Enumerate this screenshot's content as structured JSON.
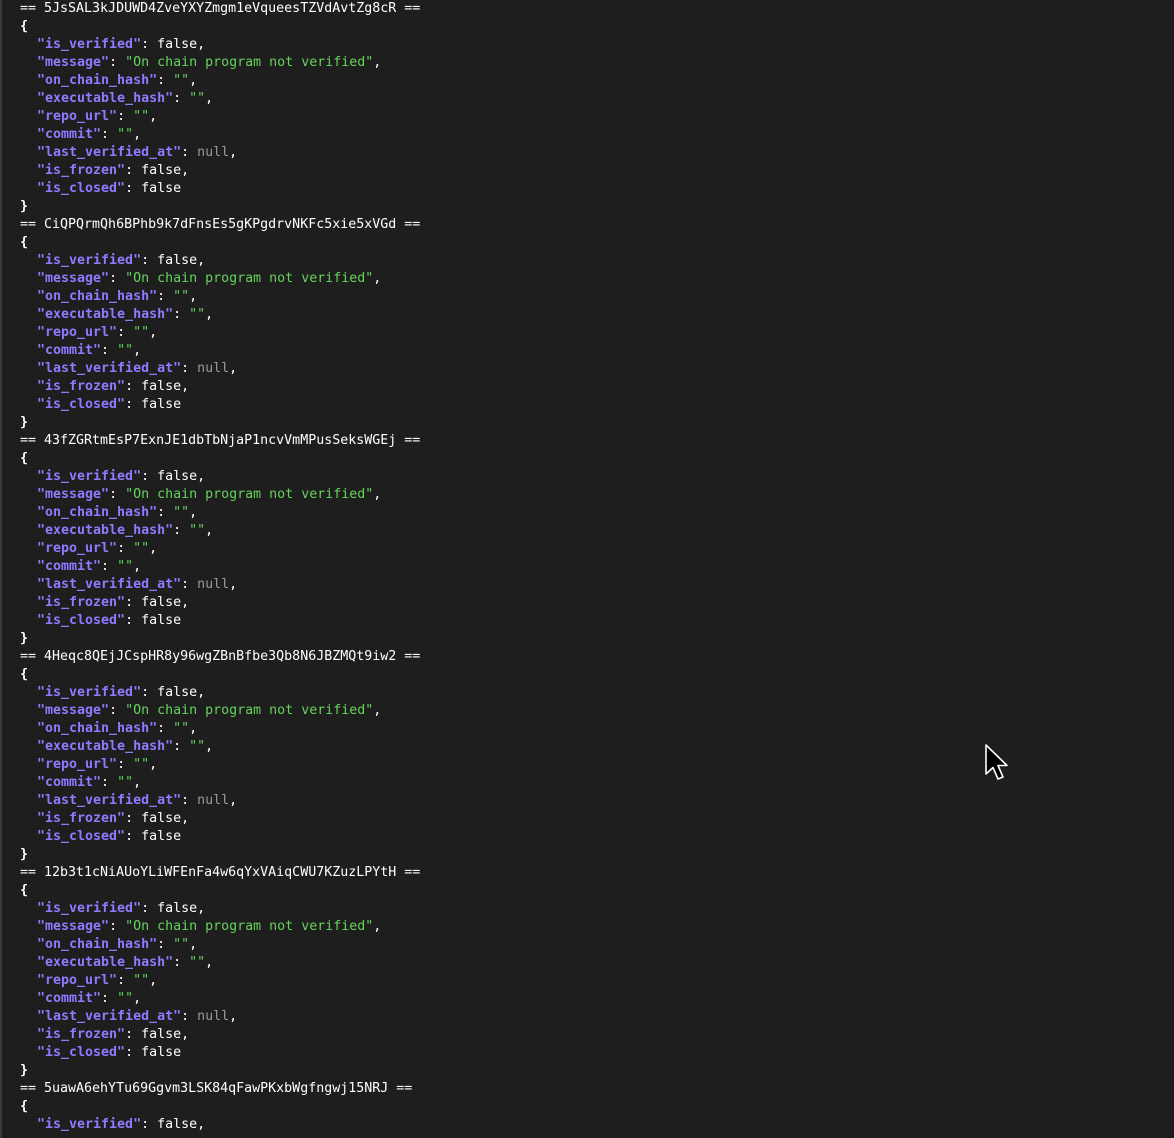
{
  "terminal": {
    "blocks": [
      {
        "header": "== 5JsSAL3kJDUWD4ZveYXYZmgm1eVqueesTZVdAvtZg8cR ==",
        "open": "{",
        "close": "}",
        "fields": [
          {
            "key": "\"is_verified\"",
            "colon": ": ",
            "value": "false",
            "type": "bool",
            "comma": ","
          },
          {
            "key": "\"message\"",
            "colon": ": ",
            "value": "\"On chain program not verified\"",
            "type": "str",
            "comma": ","
          },
          {
            "key": "\"on_chain_hash\"",
            "colon": ": ",
            "value": "\"\"",
            "type": "str",
            "comma": ","
          },
          {
            "key": "\"executable_hash\"",
            "colon": ": ",
            "value": "\"\"",
            "type": "str",
            "comma": ","
          },
          {
            "key": "\"repo_url\"",
            "colon": ": ",
            "value": "\"\"",
            "type": "str",
            "comma": ","
          },
          {
            "key": "\"commit\"",
            "colon": ": ",
            "value": "\"\"",
            "type": "str",
            "comma": ","
          },
          {
            "key": "\"last_verified_at\"",
            "colon": ": ",
            "value": "null",
            "type": "null",
            "comma": ","
          },
          {
            "key": "\"is_frozen\"",
            "colon": ": ",
            "value": "false",
            "type": "bool",
            "comma": ","
          },
          {
            "key": "\"is_closed\"",
            "colon": ": ",
            "value": "false",
            "type": "bool",
            "comma": ""
          }
        ]
      },
      {
        "header": "== CiQPQrmQh6BPhb9k7dFnsEs5gKPgdrvNKFc5xie5xVGd ==",
        "open": "{",
        "close": "}",
        "fields": [
          {
            "key": "\"is_verified\"",
            "colon": ": ",
            "value": "false",
            "type": "bool",
            "comma": ","
          },
          {
            "key": "\"message\"",
            "colon": ": ",
            "value": "\"On chain program not verified\"",
            "type": "str",
            "comma": ","
          },
          {
            "key": "\"on_chain_hash\"",
            "colon": ": ",
            "value": "\"\"",
            "type": "str",
            "comma": ","
          },
          {
            "key": "\"executable_hash\"",
            "colon": ": ",
            "value": "\"\"",
            "type": "str",
            "comma": ","
          },
          {
            "key": "\"repo_url\"",
            "colon": ": ",
            "value": "\"\"",
            "type": "str",
            "comma": ","
          },
          {
            "key": "\"commit\"",
            "colon": ": ",
            "value": "\"\"",
            "type": "str",
            "comma": ","
          },
          {
            "key": "\"last_verified_at\"",
            "colon": ": ",
            "value": "null",
            "type": "null",
            "comma": ","
          },
          {
            "key": "\"is_frozen\"",
            "colon": ": ",
            "value": "false",
            "type": "bool",
            "comma": ","
          },
          {
            "key": "\"is_closed\"",
            "colon": ": ",
            "value": "false",
            "type": "bool",
            "comma": ""
          }
        ]
      },
      {
        "header": "== 43fZGRtmEsP7ExnJE1dbTbNjaP1ncvVmMPusSeksWGEj ==",
        "open": "{",
        "close": "}",
        "fields": [
          {
            "key": "\"is_verified\"",
            "colon": ": ",
            "value": "false",
            "type": "bool",
            "comma": ","
          },
          {
            "key": "\"message\"",
            "colon": ": ",
            "value": "\"On chain program not verified\"",
            "type": "str",
            "comma": ","
          },
          {
            "key": "\"on_chain_hash\"",
            "colon": ": ",
            "value": "\"\"",
            "type": "str",
            "comma": ","
          },
          {
            "key": "\"executable_hash\"",
            "colon": ": ",
            "value": "\"\"",
            "type": "str",
            "comma": ","
          },
          {
            "key": "\"repo_url\"",
            "colon": ": ",
            "value": "\"\"",
            "type": "str",
            "comma": ","
          },
          {
            "key": "\"commit\"",
            "colon": ": ",
            "value": "\"\"",
            "type": "str",
            "comma": ","
          },
          {
            "key": "\"last_verified_at\"",
            "colon": ": ",
            "value": "null",
            "type": "null",
            "comma": ","
          },
          {
            "key": "\"is_frozen\"",
            "colon": ": ",
            "value": "false",
            "type": "bool",
            "comma": ","
          },
          {
            "key": "\"is_closed\"",
            "colon": ": ",
            "value": "false",
            "type": "bool",
            "comma": ""
          }
        ]
      },
      {
        "header": "== 4Heqc8QEjJCspHR8y96wgZBnBfbe3Qb8N6JBZMQt9iw2 ==",
        "open": "{",
        "close": "}",
        "fields": [
          {
            "key": "\"is_verified\"",
            "colon": ": ",
            "value": "false",
            "type": "bool",
            "comma": ","
          },
          {
            "key": "\"message\"",
            "colon": ": ",
            "value": "\"On chain program not verified\"",
            "type": "str",
            "comma": ","
          },
          {
            "key": "\"on_chain_hash\"",
            "colon": ": ",
            "value": "\"\"",
            "type": "str",
            "comma": ","
          },
          {
            "key": "\"executable_hash\"",
            "colon": ": ",
            "value": "\"\"",
            "type": "str",
            "comma": ","
          },
          {
            "key": "\"repo_url\"",
            "colon": ": ",
            "value": "\"\"",
            "type": "str",
            "comma": ","
          },
          {
            "key": "\"commit\"",
            "colon": ": ",
            "value": "\"\"",
            "type": "str",
            "comma": ","
          },
          {
            "key": "\"last_verified_at\"",
            "colon": ": ",
            "value": "null",
            "type": "null",
            "comma": ","
          },
          {
            "key": "\"is_frozen\"",
            "colon": ": ",
            "value": "false",
            "type": "bool",
            "comma": ","
          },
          {
            "key": "\"is_closed\"",
            "colon": ": ",
            "value": "false",
            "type": "bool",
            "comma": ""
          }
        ]
      },
      {
        "header": "== 12b3t1cNiAUoYLiWFEnFa4w6qYxVAiqCWU7KZuzLPYtH ==",
        "open": "{",
        "close": "}",
        "fields": [
          {
            "key": "\"is_verified\"",
            "colon": ": ",
            "value": "false",
            "type": "bool",
            "comma": ","
          },
          {
            "key": "\"message\"",
            "colon": ": ",
            "value": "\"On chain program not verified\"",
            "type": "str",
            "comma": ","
          },
          {
            "key": "\"on_chain_hash\"",
            "colon": ": ",
            "value": "\"\"",
            "type": "str",
            "comma": ","
          },
          {
            "key": "\"executable_hash\"",
            "colon": ": ",
            "value": "\"\"",
            "type": "str",
            "comma": ","
          },
          {
            "key": "\"repo_url\"",
            "colon": ": ",
            "value": "\"\"",
            "type": "str",
            "comma": ","
          },
          {
            "key": "\"commit\"",
            "colon": ": ",
            "value": "\"\"",
            "type": "str",
            "comma": ","
          },
          {
            "key": "\"last_verified_at\"",
            "colon": ": ",
            "value": "null",
            "type": "null",
            "comma": ","
          },
          {
            "key": "\"is_frozen\"",
            "colon": ": ",
            "value": "false",
            "type": "bool",
            "comma": ","
          },
          {
            "key": "\"is_closed\"",
            "colon": ": ",
            "value": "false",
            "type": "bool",
            "comma": ""
          }
        ]
      },
      {
        "header": "== 5uawA6ehYTu69Ggvm3LSK84qFawPKxbWgfngwj15NRJ ==",
        "open": "{",
        "close": "",
        "fields": [
          {
            "key": "\"is_verified\"",
            "colon": ": ",
            "value": "false",
            "type": "bool",
            "comma": ","
          }
        ]
      }
    ]
  },
  "colors": {
    "background": "#1e1e1e",
    "key": "#8d7cff",
    "string": "#64d45c",
    "null": "#9b9b9b",
    "text": "#ffffff"
  },
  "cursor": {
    "icon": "mouse-pointer-icon"
  }
}
